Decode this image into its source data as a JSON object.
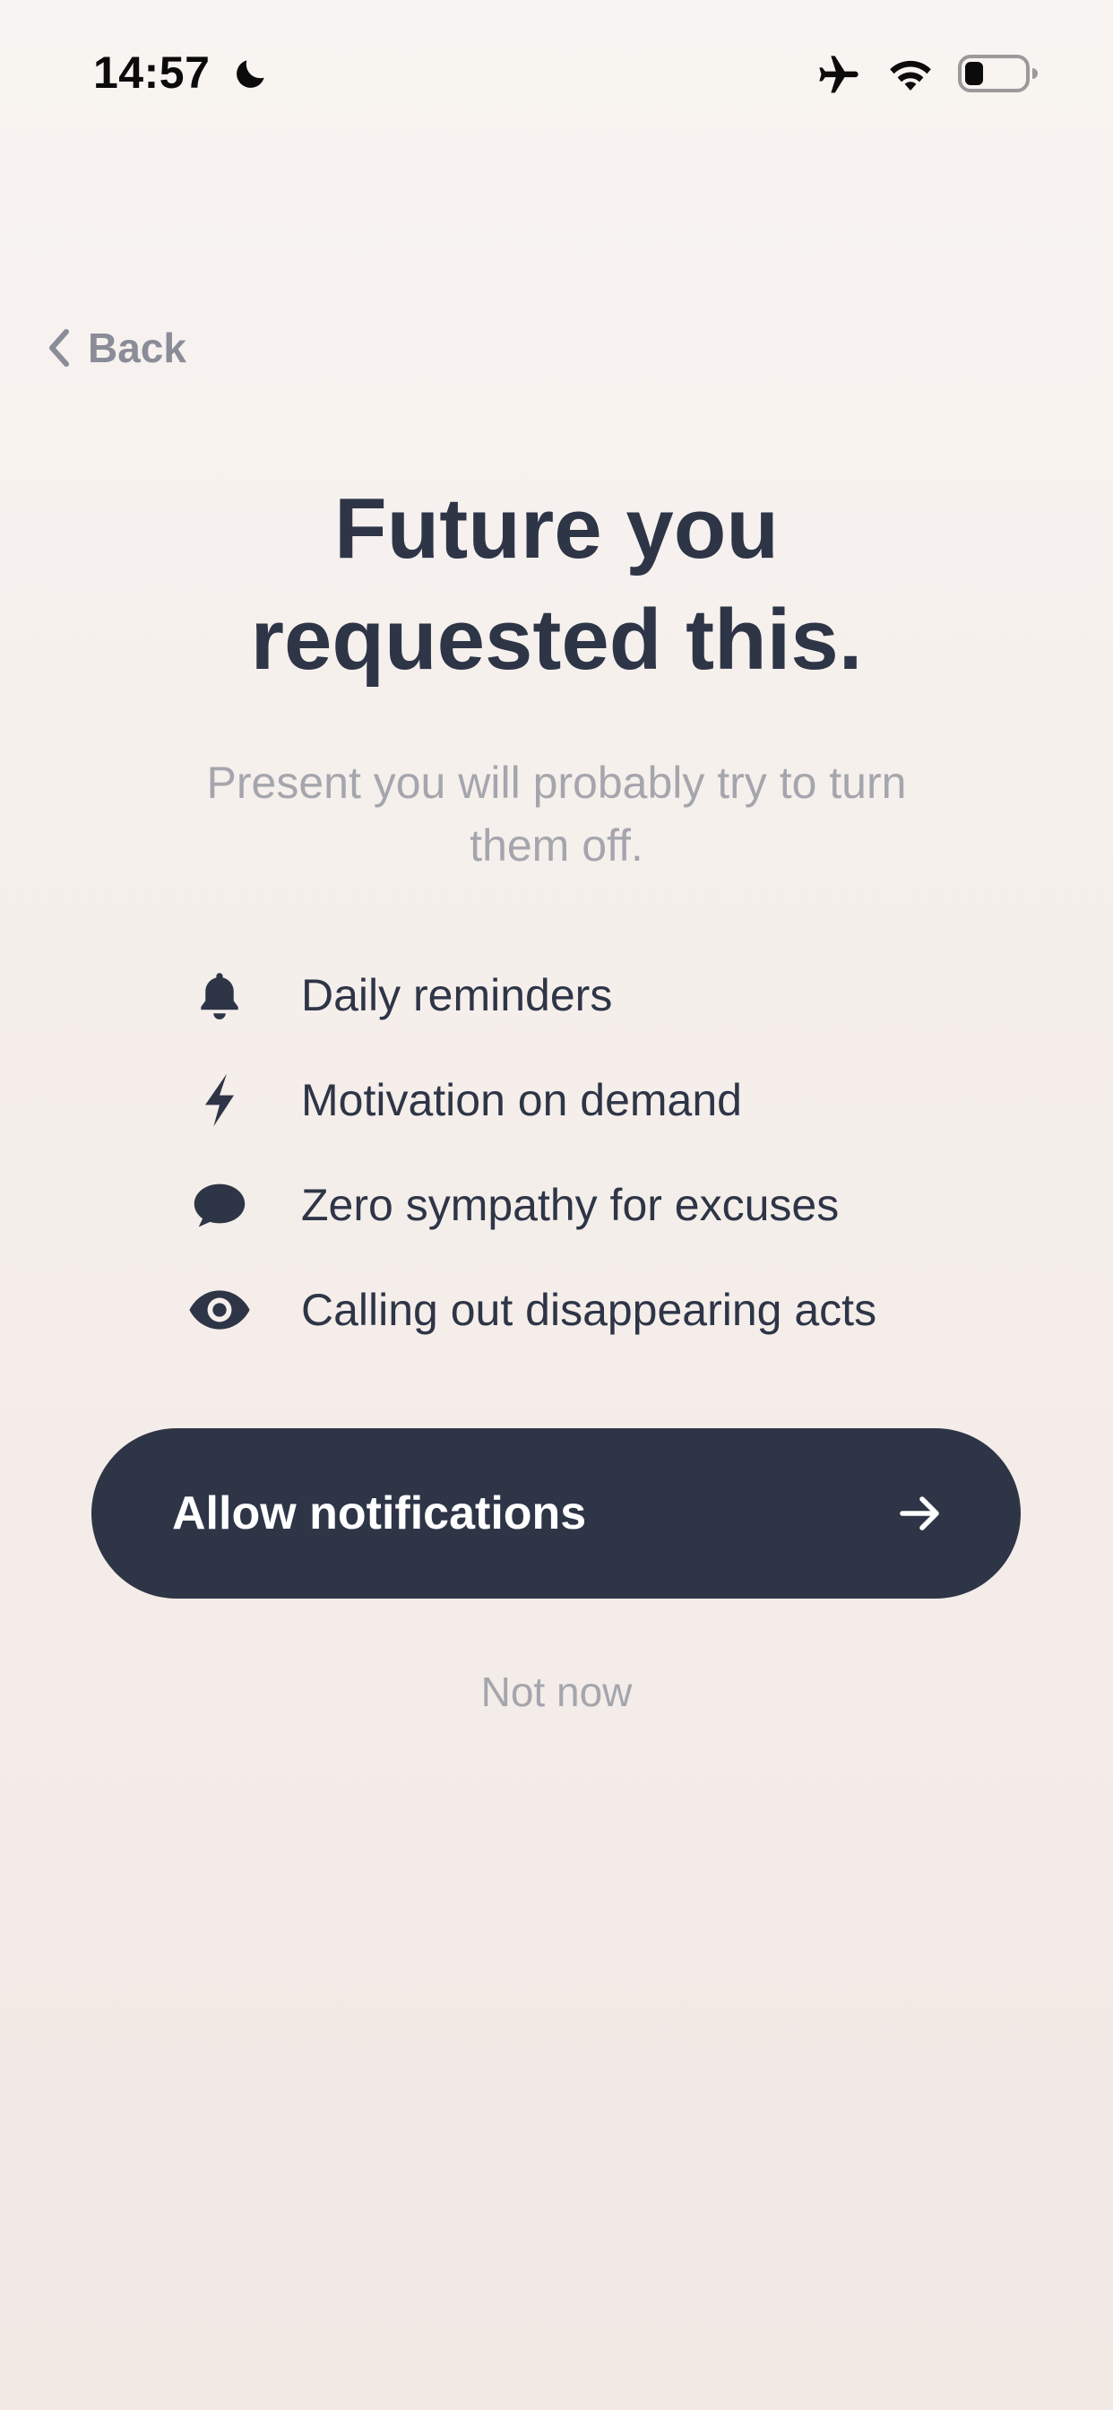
{
  "status_bar": {
    "time": "14:57",
    "icons": [
      "moon-icon",
      "airplane-icon",
      "wifi-icon",
      "battery-icon"
    ]
  },
  "nav": {
    "back_label": "Back"
  },
  "header": {
    "title_line1": "Future you",
    "title_line2": "requested this.",
    "subtitle": "Present you will probably try to turn them off."
  },
  "features": [
    {
      "icon": "bell-icon",
      "label": "Daily reminders"
    },
    {
      "icon": "lightning-icon",
      "label": "Motivation on demand"
    },
    {
      "icon": "chat-bubble-icon",
      "label": "Zero sympathy for excuses"
    },
    {
      "icon": "eye-icon",
      "label": "Calling out disappearing acts"
    }
  ],
  "actions": {
    "allow_label": "Allow notifications",
    "not_now_label": "Not now"
  },
  "colors": {
    "primary": "#2e3547",
    "muted_text": "#a5a6ad",
    "back_text": "#8a8d98",
    "background": "#f6f0ec"
  }
}
